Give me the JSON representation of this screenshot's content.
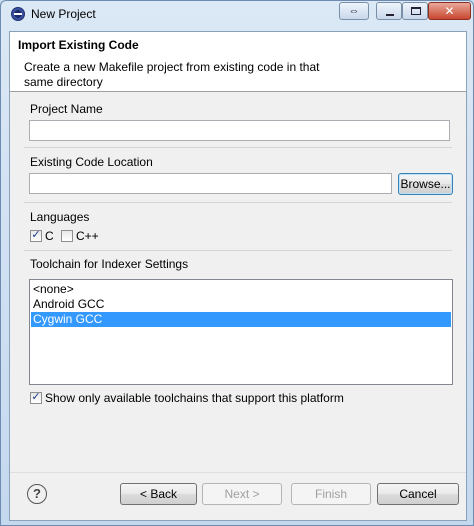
{
  "window": {
    "title": "New Project"
  },
  "titlebar_buttons": {
    "restore_icon": "⇔",
    "close_icon": "✕"
  },
  "header": {
    "title": "Import Existing Code",
    "description": "Create a new Makefile project from existing code in that same directory"
  },
  "project_name": {
    "label": "Project Name",
    "value": ""
  },
  "code_location": {
    "label": "Existing Code Location",
    "value": "",
    "browse_label": "Browse..."
  },
  "languages": {
    "label": "Languages",
    "options": [
      {
        "label": "C",
        "checked": true
      },
      {
        "label": "C++",
        "checked": false
      }
    ]
  },
  "toolchain": {
    "label": "Toolchain for Indexer Settings",
    "items": [
      "<none>",
      "Android GCC",
      "Cygwin GCC"
    ],
    "selected_index": 2
  },
  "filter": {
    "label": "Show only available toolchains that support this platform",
    "checked": true
  },
  "footer": {
    "help_icon": "?",
    "back_label": "< Back",
    "next_label": "Next >",
    "finish_label": "Finish",
    "cancel_label": "Cancel"
  },
  "colors": {
    "selection": "#3399ff",
    "header_bg": "#ffffff",
    "dialog_bg": "#f0f0f0"
  }
}
